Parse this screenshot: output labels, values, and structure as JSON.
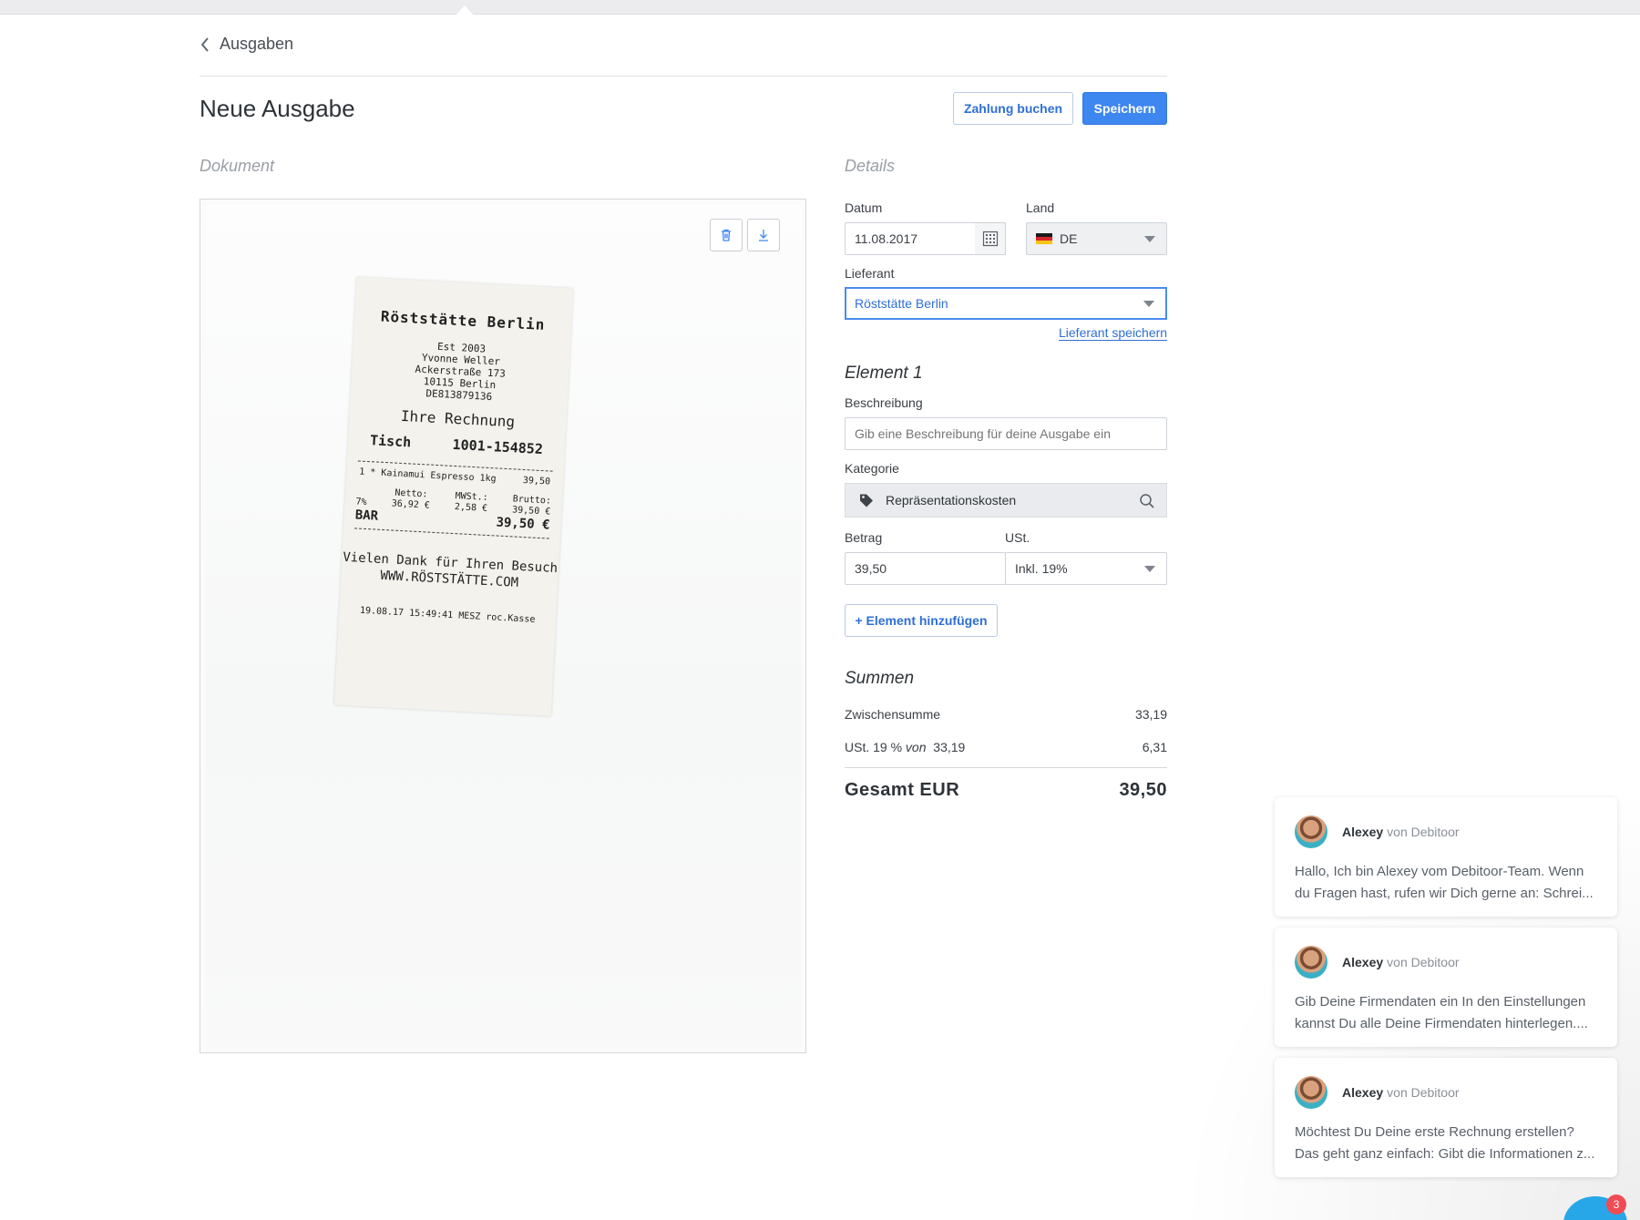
{
  "nav": {
    "back_label": "Ausgaben"
  },
  "page": {
    "title": "Neue Ausgabe"
  },
  "actions": {
    "book_payment": "Zahlung buchen",
    "save": "Speichern"
  },
  "document": {
    "section_label": "Dokument",
    "tools": [
      "trash-icon",
      "download-icon"
    ],
    "receipt": {
      "shop": "Röststätte Berlin",
      "est": "Est 2003",
      "owner": "Yvonne Weller",
      "street": "Ackerstraße 173",
      "city": "10115 Berlin",
      "tax_id": "DE813879136",
      "heading": "Ihre Rechnung",
      "table_label": "Tisch",
      "table_no": "1001-154852",
      "item": "1 * Kainamui Espresso 1kg",
      "item_price": "39,50",
      "netto_label": "Netto:",
      "netto": "36,92 €",
      "mwst_label": "MWSt.:",
      "mwst": "2,58 €",
      "brutto_label": "Brutto:",
      "brutto": "39,50 €",
      "rate": "7%",
      "payment": "BAR",
      "total": "39,50 €",
      "thanks": "Vielen Dank für Ihren Besuch",
      "web": "WWW.RÖSTSTÄTTE.COM",
      "footer": "19.08.17 15:49:41 MESZ roc.Kasse"
    }
  },
  "details": {
    "section_label": "Details",
    "date_label": "Datum",
    "date_value": "11.08.2017",
    "country_label": "Land",
    "country_value": "DE",
    "supplier_label": "Lieferant",
    "supplier_value": "Röststätte Berlin",
    "save_supplier": "Lieferant speichern"
  },
  "element": {
    "title": "Element 1",
    "description_label": "Beschreibung",
    "description_placeholder": "Gib eine Beschreibung für deine Ausgabe ein",
    "category_label": "Kategorie",
    "category_value": "Repräsentationskosten",
    "amount_label": "Betrag",
    "amount_value": "39,50",
    "vat_label": "USt.",
    "vat_value": "Inkl. 19%",
    "add_element": "+ Element hinzufügen"
  },
  "totals": {
    "title": "Summen",
    "subtotal_label": "Zwischensumme",
    "subtotal_value": "33,19",
    "vat_label": "USt. 19 %",
    "vat_of": "von",
    "vat_base": "33,19",
    "vat_value": "6,31",
    "total_label": "Gesamt EUR",
    "total_value": "39,50"
  },
  "chat": {
    "messages": [
      {
        "author": "Alexey",
        "org": "von Debitoor",
        "text": "Hallo, Ich bin Alexey vom Debitoor-Team. Wenn du Fragen hast, rufen wir Dich gerne an: Schrei..."
      },
      {
        "author": "Alexey",
        "org": "von Debitoor",
        "text": "Gib Deine Firmendaten ein In den Einstellungen kannst Du alle Deine Firmendaten hinterlegen...."
      },
      {
        "author": "Alexey",
        "org": "von Debitoor",
        "text": "Möchtest Du Deine erste Rechnung erstellen? Das geht ganz einfach: Gibt die Informationen z..."
      }
    ],
    "unread_count": "3"
  },
  "colors": {
    "accent": "#3e86f0",
    "link": "#2f6fd6",
    "badge": "#ef4b55",
    "launcher": "#27a7e8"
  }
}
